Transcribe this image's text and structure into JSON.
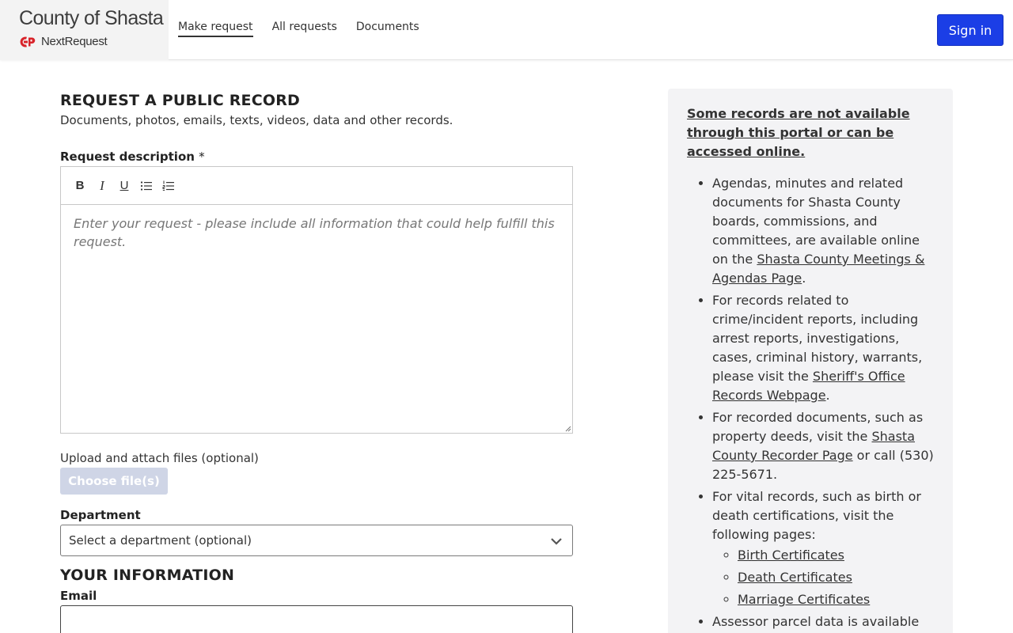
{
  "header": {
    "org_title": "County of Shasta",
    "product_name": "NextRequest",
    "nav": [
      {
        "label": "Make request",
        "active": true
      },
      {
        "label": "All requests",
        "active": false
      },
      {
        "label": "Documents",
        "active": false
      }
    ],
    "sign_in_label": "Sign in",
    "accent_color": "#1b3ee6"
  },
  "form": {
    "title": "REQUEST A PUBLIC RECORD",
    "subtitle": "Documents, photos, emails, texts, videos, data and other records.",
    "description_label": "Request description",
    "required_mark": "*",
    "toolbar_icons": [
      "bold-icon",
      "italic-icon",
      "underline-icon",
      "bulleted-list-icon",
      "numbered-list-icon"
    ],
    "toolbar": {
      "bold": "B",
      "italic": "I",
      "underline": "U"
    },
    "description_placeholder": "Enter your request - please include all information that could help fulfill this request.",
    "upload_label": "Upload and attach files (optional)",
    "upload_button": "Choose file(s)",
    "department_label": "Department",
    "department_selected": "Select a department (optional)",
    "your_info_title": "YOUR INFORMATION",
    "email_label": "Email",
    "email_value": ""
  },
  "aside": {
    "title": "Some records are not available through this portal or can be accessed online.",
    "items": [
      {
        "pre": "Agendas, minutes and related documents for Shasta County boards, commissions, and committees, are available online on the ",
        "link": "Shasta County Meetings & Agendas Page",
        "post": "."
      },
      {
        "pre": "For records related to crime/incident reports, including arrest reports, investigations, cases, criminal history, warrants, please visit the ",
        "link": "Sheriff's Office Records Webpage",
        "post": "."
      },
      {
        "pre": "For recorded documents, such as property deeds, visit the ",
        "link": "Shasta County Recorder Page",
        "post": " or call (530) 225-5671."
      },
      {
        "pre": "For vital records, such as birth or death certifications, visit the following pages:",
        "sub_links": [
          "Birth Certificates",
          "Death Certificates",
          "Marriage Certificates"
        ]
      },
      {
        "pre": "Assessor parcel data is available"
      }
    ]
  }
}
